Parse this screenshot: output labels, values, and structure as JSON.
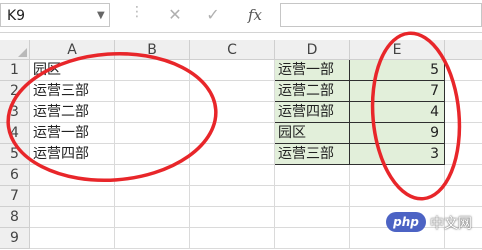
{
  "formula_bar": {
    "name_box": "K9",
    "separator": "⋮",
    "cancel_icon": "✕",
    "enter_icon": "✓",
    "fx_label": "fx",
    "formula_value": ""
  },
  "columns": [
    "A",
    "B",
    "C",
    "D",
    "E"
  ],
  "rows": [
    "1",
    "2",
    "3",
    "4",
    "5",
    "6",
    "7",
    "8",
    "9"
  ],
  "column_a": [
    "园区",
    "运营三部",
    "运营二部",
    "运营一部",
    "运营四部"
  ],
  "table_de": [
    {
      "d": "运营一部",
      "e": "5"
    },
    {
      "d": "运营二部",
      "e": "7"
    },
    {
      "d": "运营四部",
      "e": "4"
    },
    {
      "d": "园区",
      "e": "9"
    },
    {
      "d": "运营三部",
      "e": "3"
    }
  ],
  "watermark": {
    "logo": "php",
    "text": "中文网"
  },
  "colors": {
    "highlight": "#e2efda",
    "annotation": "#e8262a"
  }
}
